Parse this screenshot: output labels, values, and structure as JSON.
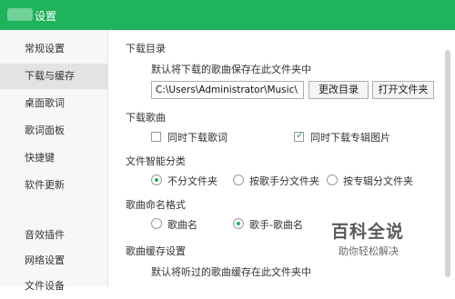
{
  "window": {
    "title": "设置"
  },
  "sidebar": {
    "items": [
      {
        "label": "常规设置",
        "active": false
      },
      {
        "label": "下载与缓存",
        "active": true
      },
      {
        "label": "桌面歌词",
        "active": false
      },
      {
        "label": "歌词面板",
        "active": false
      },
      {
        "label": "快捷键",
        "active": false
      },
      {
        "label": "软件更新",
        "active": false
      },
      {
        "label": "音效插件",
        "active": false
      },
      {
        "label": "网络设置",
        "active": false
      },
      {
        "label": "文件设备",
        "active": false
      }
    ]
  },
  "download_dir": {
    "title": "下载目录",
    "desc": "默认将下载的歌曲保存在此文件夹中",
    "path": "C:\\Users\\Administrator\\Music\\",
    "change_btn": "更改目录",
    "open_btn": "打开文件夹"
  },
  "download_song": {
    "title": "下载歌曲",
    "opt_lyrics": {
      "label": "同时下载歌词",
      "checked": false
    },
    "opt_cover": {
      "label": "同时下载专辑图片",
      "checked": true
    }
  },
  "smart_classify": {
    "title": "文件智能分类",
    "options": [
      {
        "label": "不分文件夹",
        "selected": true
      },
      {
        "label": "按歌手分文件夹",
        "selected": false
      },
      {
        "label": "按专辑分文件夹",
        "selected": false
      }
    ]
  },
  "naming": {
    "title": "歌曲命名格式",
    "options": [
      {
        "label": "歌曲名",
        "selected": false
      },
      {
        "label": "歌手-歌曲名",
        "selected": true
      }
    ]
  },
  "cache": {
    "title": "歌曲缓存设置",
    "desc": "默认将听过的歌曲缓存在此文件夹中"
  },
  "watermark": {
    "main": "百科全说",
    "sub": "助你轻松解决"
  },
  "colors": {
    "accent": "#1fb35c",
    "titlebar": "#1fb35c"
  }
}
